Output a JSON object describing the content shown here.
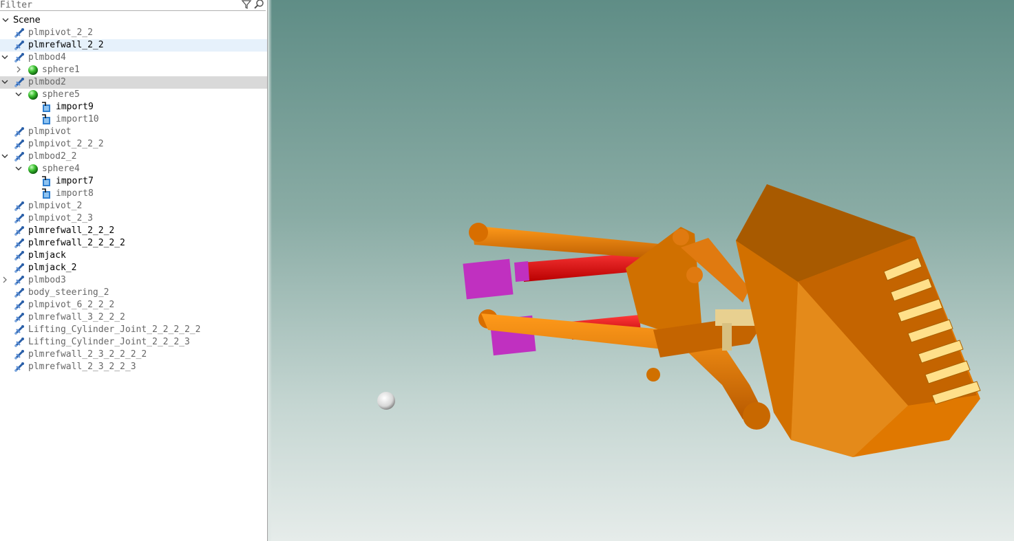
{
  "filter": {
    "placeholder": "Filter"
  },
  "tree": {
    "root_label": "Scene",
    "nodes": [
      {
        "label": "plmpivot_2_2",
        "icon": "joint-icon",
        "color": "#666666"
      },
      {
        "label": "plmrefwall_2_2",
        "icon": "joint-icon",
        "color": "#000000",
        "selected": true
      },
      {
        "label": "plmbod4",
        "icon": "joint-icon",
        "color": "#666666",
        "expanded": true
      },
      {
        "label": "sphere1",
        "icon": "sphere-icon",
        "color": "#666666",
        "collapsed": true
      },
      {
        "label": "plmbod2",
        "icon": "joint-icon",
        "color": "#666666",
        "expanded": true,
        "highlighted": true
      },
      {
        "label": "sphere5",
        "icon": "sphere-icon",
        "color": "#666666",
        "expanded": true
      },
      {
        "label": "import9",
        "icon": "import-icon",
        "color": "#000000"
      },
      {
        "label": "import10",
        "icon": "import-icon",
        "color": "#666666"
      },
      {
        "label": "plmpivot",
        "icon": "joint-icon",
        "color": "#666666"
      },
      {
        "label": "plmpivot_2_2_2",
        "icon": "joint-icon",
        "color": "#666666"
      },
      {
        "label": "plmbod2_2",
        "icon": "joint-icon",
        "color": "#666666",
        "expanded": true
      },
      {
        "label": "sphere4",
        "icon": "sphere-icon",
        "color": "#666666",
        "expanded": true
      },
      {
        "label": "import7",
        "icon": "import-icon",
        "color": "#000000"
      },
      {
        "label": "import8",
        "icon": "import-icon",
        "color": "#666666"
      },
      {
        "label": "plmpivot_2",
        "icon": "joint-icon",
        "color": "#666666"
      },
      {
        "label": "plmpivot_2_3",
        "icon": "joint-icon",
        "color": "#666666"
      },
      {
        "label": "plmrefwall_2_2_2",
        "icon": "joint-icon",
        "color": "#000000"
      },
      {
        "label": "plmrefwall_2_2_2_2",
        "icon": "joint-icon",
        "color": "#000000"
      },
      {
        "label": "plmjack",
        "icon": "joint-icon",
        "color": "#000000"
      },
      {
        "label": "plmjack_2",
        "icon": "joint-icon",
        "color": "#000000"
      },
      {
        "label": "plmbod3",
        "icon": "joint-icon",
        "color": "#666666",
        "collapsed": true
      },
      {
        "label": "body_steering_2",
        "icon": "joint-icon",
        "color": "#666666"
      },
      {
        "label": "plmpivot_6_2_2_2",
        "icon": "joint-icon",
        "color": "#666666"
      },
      {
        "label": "plmrefwall_3_2_2_2",
        "icon": "joint-icon",
        "color": "#666666"
      },
      {
        "label": "Lifting_Cylinder_Joint_2_2_2_2_2",
        "icon": "joint-icon",
        "color": "#666666"
      },
      {
        "label": "Lifting_Cylinder_Joint_2_2_2_3",
        "icon": "joint-icon",
        "color": "#666666"
      },
      {
        "label": "plmrefwall_2_3_2_2_2_2",
        "icon": "joint-icon",
        "color": "#666666"
      },
      {
        "label": "plmrefwall_2_3_2_2_3",
        "icon": "joint-icon",
        "color": "#666666"
      }
    ]
  },
  "viewport": {
    "background_top": "#5f8d86",
    "background_bottom": "#e6ecea",
    "model_color": "#e07800",
    "cylinder_color": "#e00000",
    "block_color": "#c030c0",
    "sphere_color": "#f0f0f0"
  }
}
